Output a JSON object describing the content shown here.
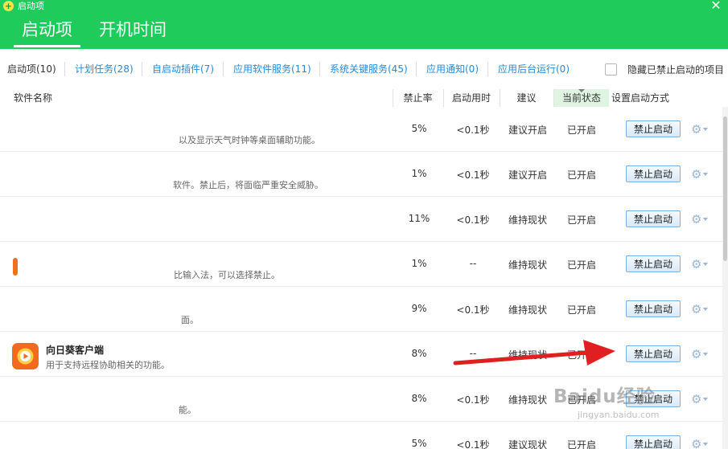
{
  "window": {
    "title": "启动项",
    "accent_color": "#1fcb5a"
  },
  "main_tabs": [
    {
      "label": "启动项",
      "active": true
    },
    {
      "label": "开机时间",
      "active": false
    }
  ],
  "sub_tabs": [
    {
      "label": "启动项(10)",
      "active": true
    },
    {
      "label": "计划任务(28)",
      "active": false
    },
    {
      "label": "自启动插件(7)",
      "active": false
    },
    {
      "label": "应用软件服务(11)",
      "active": false
    },
    {
      "label": "系统关键服务(45)",
      "active": false
    },
    {
      "label": "应用通知(0)",
      "active": false
    },
    {
      "label": "应用后台运行(0)",
      "active": false
    }
  ],
  "hide_disabled": {
    "label": "隐藏已禁止启动的项目",
    "checked": false
  },
  "columns": {
    "name": "软件名称",
    "rate": "禁止率",
    "time": "启动用时",
    "suggestion": "建议",
    "status": "当前状态",
    "action": "设置启动方式"
  },
  "rows": [
    {
      "name": "",
      "desc": "以及显示天气时钟等桌面辅助功能。",
      "rate": "5%",
      "time": "<0.1秒",
      "suggestion": "建议开启",
      "status": "已开启",
      "action": "禁止启动"
    },
    {
      "name": "",
      "desc": "软件。禁止后，将面临严重安全威胁。",
      "rate": "1%",
      "time": "<0.1秒",
      "suggestion": "建议开启",
      "status": "已开启",
      "action": "禁止启动"
    },
    {
      "name": "",
      "desc": "",
      "rate": "11%",
      "time": "<0.1秒",
      "suggestion": "维持现状",
      "status": "已开启",
      "action": "禁止启动"
    },
    {
      "name": "",
      "desc": "比输入法，可以选择禁止。",
      "rate": "1%",
      "time": "--",
      "suggestion": "维持现状",
      "status": "已开启",
      "action": "禁止启动"
    },
    {
      "name": "",
      "desc": "面。",
      "rate": "9%",
      "time": "<0.1秒",
      "suggestion": "维持现状",
      "status": "已开启",
      "action": "禁止启动"
    },
    {
      "name": "向日葵客户端",
      "desc": "用于支持远程协助相关的功能。",
      "rate": "8%",
      "time": "--",
      "suggestion": "维持现状",
      "status": "已开启",
      "action": "禁止启动"
    },
    {
      "name": "",
      "desc": "能。",
      "rate": "8%",
      "time": "<0.1秒",
      "suggestion": "维持现状",
      "status": "已开启",
      "action": "禁止启动"
    },
    {
      "name": "",
      "desc": "",
      "rate": "5%",
      "time": "<0.1秒",
      "suggestion": "建议现状",
      "status": "已开启",
      "action": "禁止启动"
    }
  ],
  "watermark": {
    "main": "Baidu经验",
    "sub": "jingyan.baidu.com"
  },
  "annotation_arrow_color": "#e02020"
}
